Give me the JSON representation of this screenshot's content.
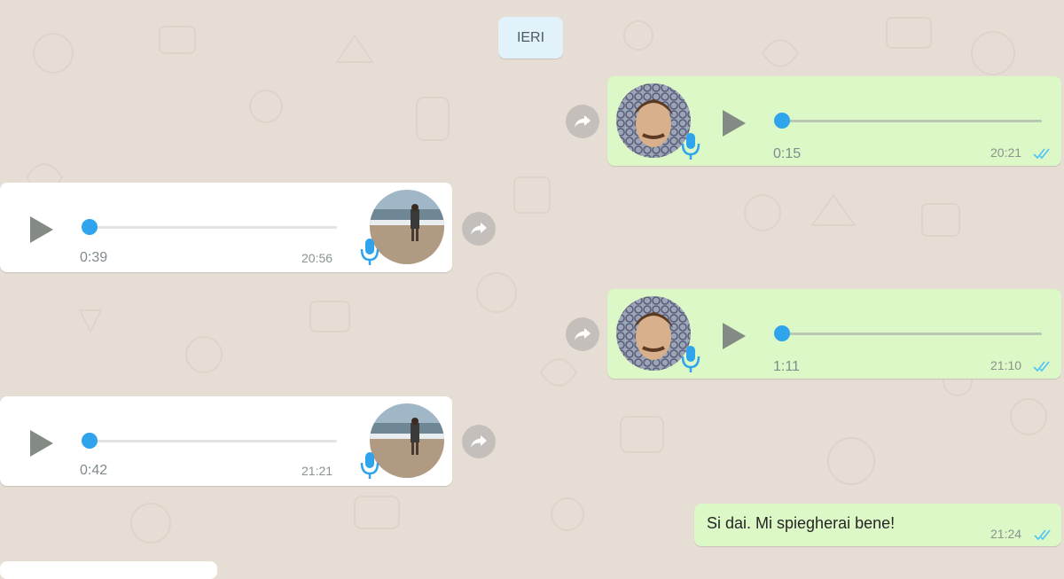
{
  "colors": {
    "background": "#e6ddd4",
    "outgoing_bubble": "#dcf8c6",
    "incoming_bubble": "#ffffff",
    "accent_blue": "#2fa3ec",
    "read_ticks": "#4fc3f7"
  },
  "date_separator": "IERI",
  "messages": [
    {
      "direction": "outgoing",
      "type": "voice",
      "duration": "0:15",
      "time": "20:21",
      "status": "read",
      "icons": [
        "play-icon",
        "mic-icon",
        "forward-icon",
        "double-check-icon"
      ]
    },
    {
      "direction": "incoming",
      "type": "voice",
      "duration": "0:39",
      "time": "20:56",
      "icons": [
        "play-icon",
        "mic-icon",
        "forward-icon"
      ]
    },
    {
      "direction": "outgoing",
      "type": "voice",
      "duration": "1:11",
      "time": "21:10",
      "status": "read",
      "icons": [
        "play-icon",
        "mic-icon",
        "forward-icon",
        "double-check-icon"
      ]
    },
    {
      "direction": "incoming",
      "type": "voice",
      "duration": "0:42",
      "time": "21:21",
      "icons": [
        "play-icon",
        "mic-icon",
        "forward-icon"
      ]
    },
    {
      "direction": "outgoing",
      "type": "text",
      "text": "Si dai. Mi spiegherai bene!",
      "time": "21:24",
      "status": "read",
      "icons": [
        "double-check-icon"
      ]
    }
  ]
}
